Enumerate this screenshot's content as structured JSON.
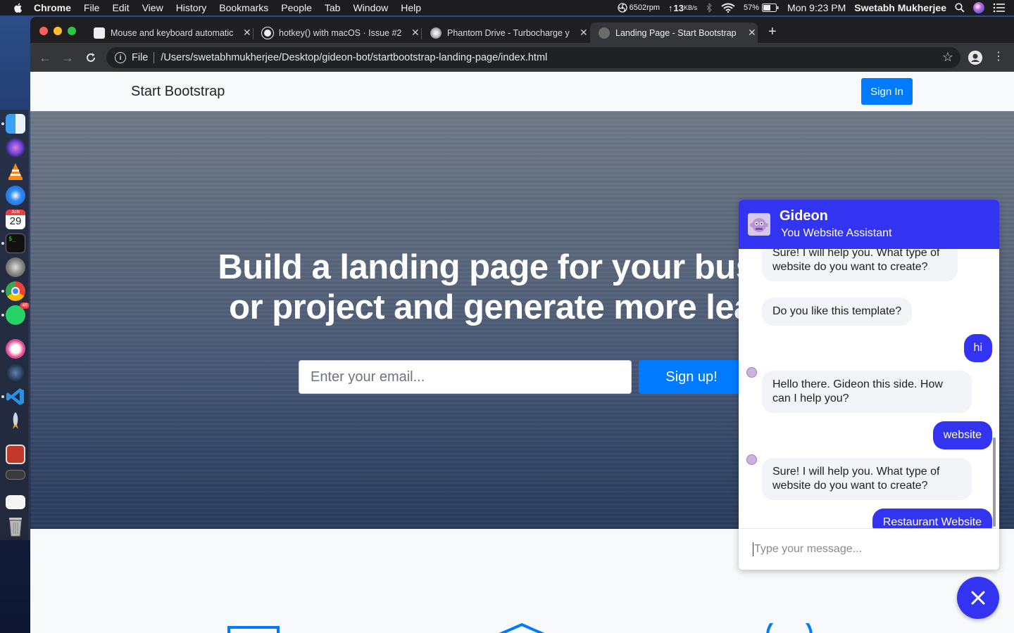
{
  "menubar": {
    "app_name": "Chrome",
    "menus": [
      "File",
      "Edit",
      "View",
      "History",
      "Bookmarks",
      "People",
      "Tab",
      "Window",
      "Help"
    ],
    "fan_speed": "6502rpm",
    "network_speed": "13",
    "network_unit": "KB/s",
    "battery_percent": "57%",
    "clock": "Mon 9:23 PM",
    "user_name": "Swetabh  Mukherjee"
  },
  "browser": {
    "tabs": [
      {
        "title": "Mouse and keyboard automatic",
        "active": false
      },
      {
        "title": "hotkey() with macOS · Issue #2",
        "active": false
      },
      {
        "title": "Phantom Drive - Turbocharge y",
        "active": false
      },
      {
        "title": "Landing Page - Start Bootstrap",
        "active": true
      }
    ],
    "scheme_label": "File",
    "url": "/Users/swetabhmukherjee/Desktop/gideon-bot/startbootstrap-landing-page/index.html"
  },
  "page": {
    "brand": "Start Bootstrap",
    "sign_in_label": "Sign In",
    "headline_line1": "Build a landing page for your busi",
    "headline_line2": "or project and generate more lea",
    "email_placeholder": "Enter your email...",
    "signup_label": "Sign up!"
  },
  "chat": {
    "bot_name": "Gideon",
    "bot_subtitle": "You Website Assistant",
    "messages": [
      {
        "from": "bot",
        "text": "Sure! I will help you. What type of website do you want to create?"
      },
      {
        "from": "bot",
        "text": "Do you like this template?"
      },
      {
        "from": "user",
        "text": "hi"
      },
      {
        "from": "bot",
        "text": "Hello there. Gideon this side. How can I help you?"
      },
      {
        "from": "user",
        "text": "website"
      },
      {
        "from": "bot",
        "text": "Sure! I will help you. What type of website do you want to create?"
      },
      {
        "from": "user",
        "text": "Restaurant Website"
      }
    ],
    "input_placeholder": "Type your message...",
    "accent_color": "#3333f2"
  },
  "dock": {
    "calendar_month": "JUN",
    "calendar_day": "29",
    "whatsapp_badge": "48"
  },
  "colors": {
    "primary_button": "#007bff",
    "chat_accent": "#3333f2"
  }
}
